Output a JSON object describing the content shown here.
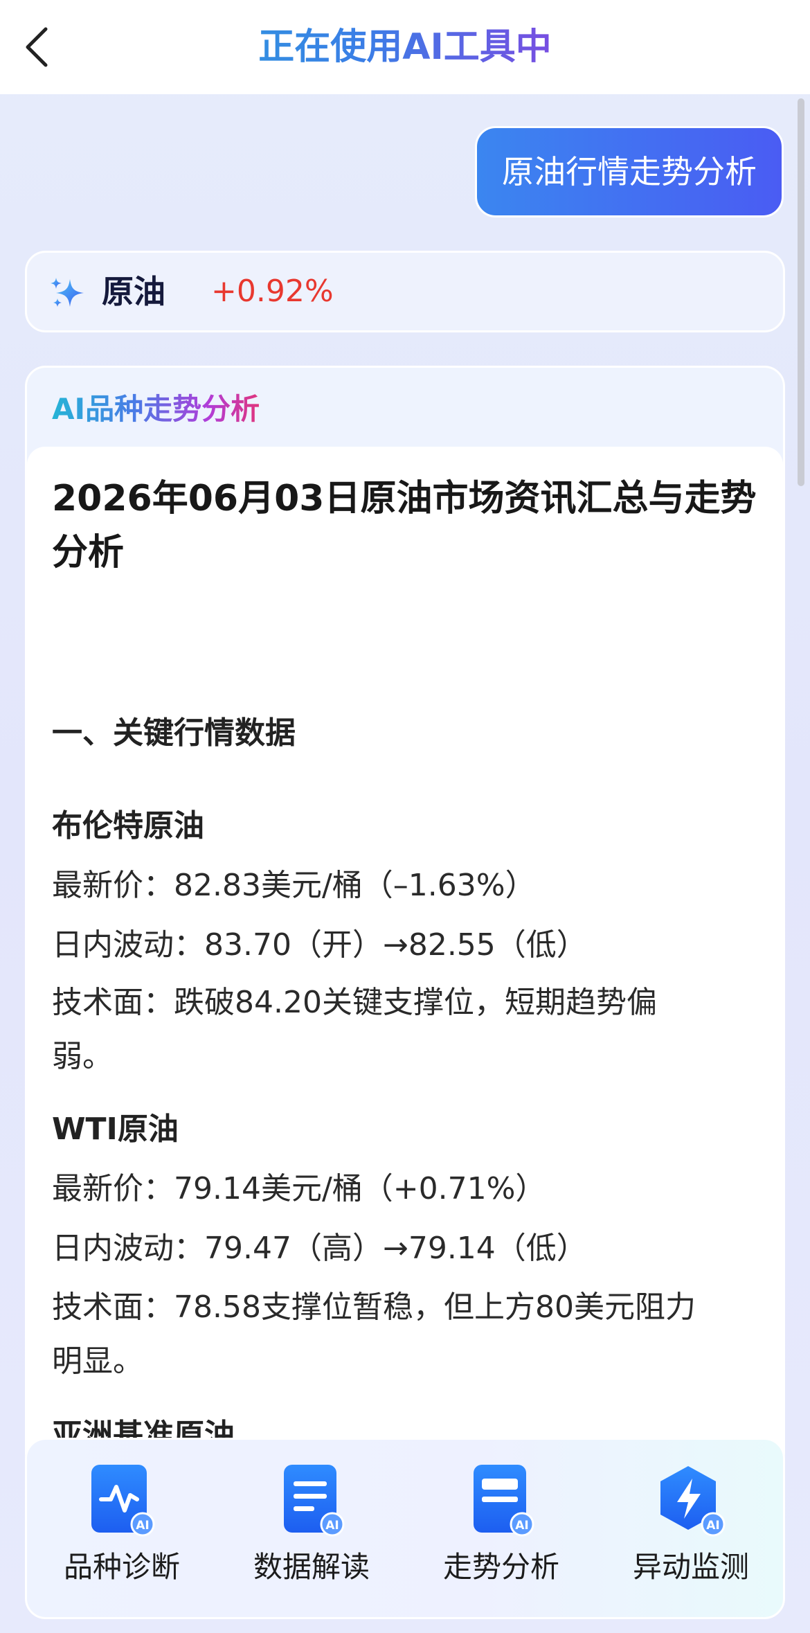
{
  "header": {
    "title": "正在使用AI工具中"
  },
  "user_message": "原油行情走势分析",
  "quote": {
    "name": "原油",
    "change": "+0.92%"
  },
  "analysis": {
    "label": "AI品种走势分析",
    "title": "2026年06月03日原油市场资讯汇总与走势分析",
    "section1": "一、关键行情数据",
    "brent": {
      "name": "布伦特原油",
      "price": "最新价：82.83美元/桶（–1.63%）",
      "range": "日内波动：83.70（开）→82.55（低）",
      "tech": "技术面：跌破84.20关键支撑位，短期趋势偏弱。"
    },
    "wti": {
      "name": "WTI原油",
      "price": "最新价：79.14美元/桶（+0.71%）",
      "range": "日内波动：79.47（高）→79.14（低）",
      "tech": "技术面：78.58支撑位暂稳，但上方80美元阻力明显。"
    },
    "asia": {
      "name": "亚洲基准原油"
    }
  },
  "toolbar": {
    "items": [
      {
        "label": "品种诊断",
        "icon": "pulse-chart-icon"
      },
      {
        "label": "数据解读",
        "icon": "document-lines-icon"
      },
      {
        "label": "走势分析",
        "icon": "document-bars-icon"
      },
      {
        "label": "异动监测",
        "icon": "lightning-hexagon-icon"
      }
    ]
  },
  "colors": {
    "accent_blue": "#3b6cf2",
    "up_red": "#e8382f"
  }
}
